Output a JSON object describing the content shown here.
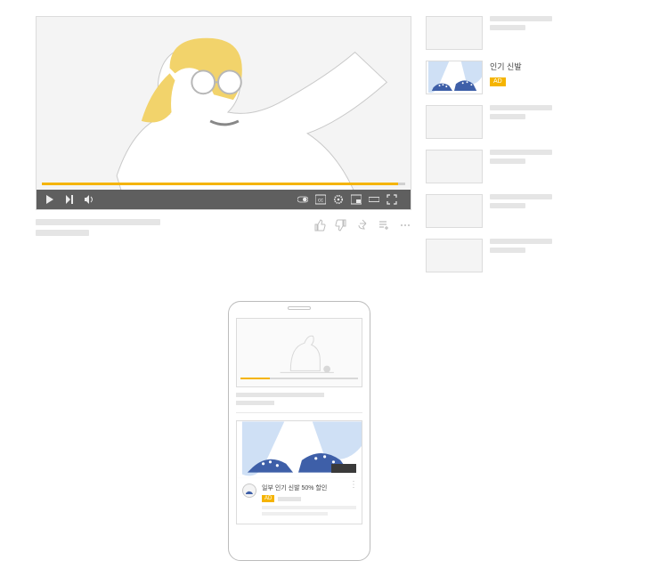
{
  "colors": {
    "accent": "#f5b400",
    "controls_bg": "#5f5f5f",
    "outline": "#dcdcdc",
    "skeleton": "#e5e5e5"
  },
  "desktop": {
    "player": {
      "illustration": "woman-sunglasses",
      "progress_percent": 98,
      "controls": {
        "left_icons": [
          "play-icon",
          "next-icon",
          "volume-icon"
        ],
        "right_icons": [
          "autoplay-toggle-icon",
          "captions-icon",
          "settings-gear-icon",
          "miniplayer-icon",
          "theater-icon",
          "fullscreen-icon"
        ]
      }
    },
    "below_actions": [
      "thumbs-up-icon",
      "thumbs-down-icon",
      "share-icon",
      "save-playlist-icon",
      "more-icon"
    ],
    "sidebar": [
      {
        "kind": "placeholder"
      },
      {
        "kind": "ad",
        "title": "인기 신발",
        "badge": "AD",
        "thumb": "sneaker"
      },
      {
        "kind": "placeholder"
      },
      {
        "kind": "placeholder"
      },
      {
        "kind": "placeholder"
      },
      {
        "kind": "placeholder"
      }
    ]
  },
  "mobile": {
    "player": {
      "illustration": "dog-with-ball",
      "progress_percent": 25
    },
    "ad_card": {
      "thumb": "sneaker",
      "headline": "일부 인기 신발 50% 할인",
      "badge": "AD",
      "cta_style": "dark-button",
      "avatar": "sneaker-logo"
    }
  }
}
